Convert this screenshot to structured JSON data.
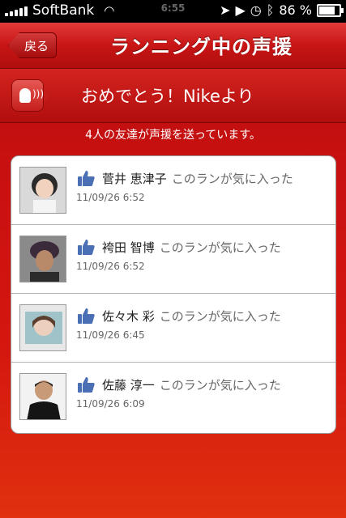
{
  "status_bar": {
    "carrier": "SoftBank",
    "time": "6:55",
    "battery": "86 %"
  },
  "nav": {
    "back_label": "戻る",
    "title": "ランニング中の声援"
  },
  "banner": {
    "text": "おめでとう！Nikeより"
  },
  "subtitle": "4人の友達が声援を送っています。",
  "cheers": [
    {
      "name": "菅井 恵津子",
      "message": "このランが気に入った",
      "time": "11/09/26  6:52"
    },
    {
      "name": "袴田 智博",
      "message": "このランが気に入った",
      "time": "11/09/26  6:52"
    },
    {
      "name": "佐々木 彩",
      "message": "このランが気に入った",
      "time": "11/09/26  6:45"
    },
    {
      "name": "佐藤 淳一",
      "message": "このランが気に入った",
      "time": "11/09/26  6:09"
    }
  ],
  "colors": {
    "accent": "#c81010",
    "like": "#4a6fb5"
  }
}
